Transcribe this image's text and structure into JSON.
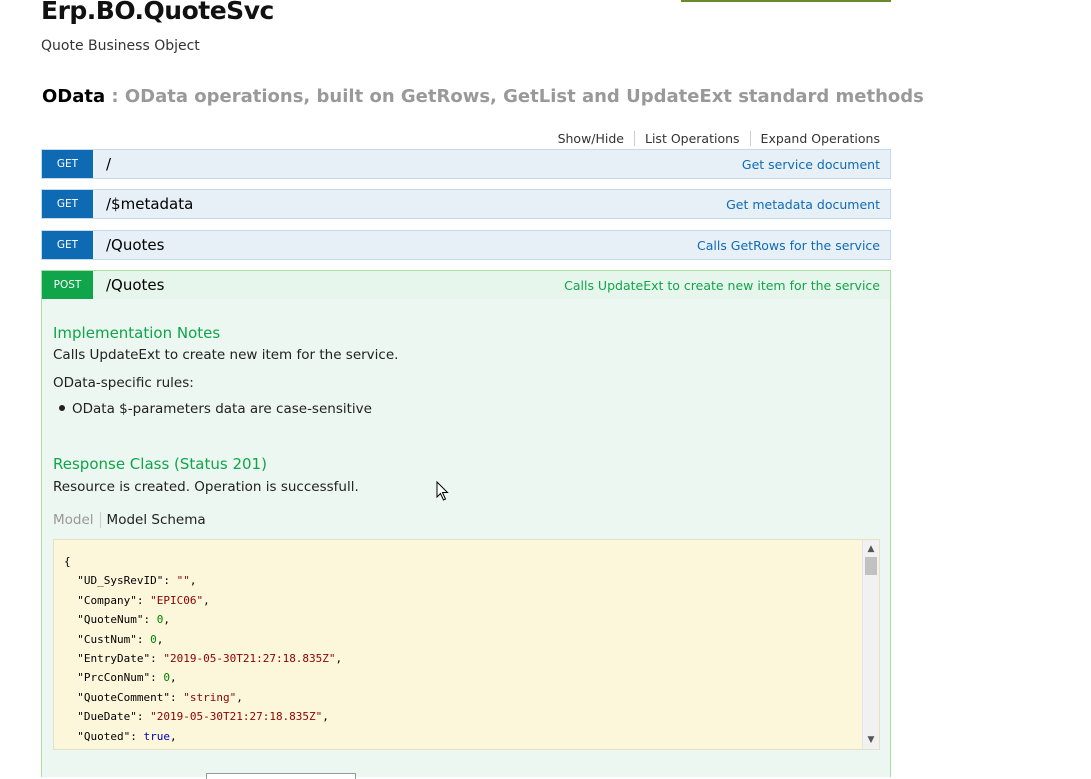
{
  "service": {
    "title": "Erp.BO.QuoteSvc",
    "subtitle": "Quote Business Object"
  },
  "section": {
    "name": "OData",
    "separator": " : ",
    "description": "OData operations, built on GetRows, GetList and UpdateExt standard methods"
  },
  "ops_links": [
    "Show/Hide",
    "List Operations",
    "Expand Operations"
  ],
  "operations": [
    {
      "method": "GET",
      "path": "/",
      "summary": "Get service document"
    },
    {
      "method": "GET",
      "path": "/$metadata",
      "summary": "Get metadata document"
    },
    {
      "method": "GET",
      "path": "/Quotes",
      "summary": "Calls GetRows for the service"
    },
    {
      "method": "POST",
      "path": "/Quotes",
      "summary": "Calls UpdateExt to create new item for the service"
    }
  ],
  "post_detail": {
    "impl_heading": "Implementation Notes",
    "impl_text": "Calls UpdateExt to create new item for the service.",
    "rules_heading": "OData-specific rules:",
    "rules": [
      "OData $-parameters data are case-sensitive"
    ],
    "response_heading": "Response Class (Status 201)",
    "response_text": "Resource is created. Operation is successfull.",
    "tabs": {
      "model": "Model",
      "schema": "Model Schema"
    },
    "schema_open": "{",
    "schema_fields": [
      {
        "key": "\"UD_SysRevID\"",
        "value": "\"\"",
        "kind": "s"
      },
      {
        "key": "\"Company\"",
        "value": "\"EPIC06\"",
        "kind": "s"
      },
      {
        "key": "\"QuoteNum\"",
        "value": "0",
        "kind": "n"
      },
      {
        "key": "\"CustNum\"",
        "value": "0",
        "kind": "n"
      },
      {
        "key": "\"EntryDate\"",
        "value": "\"2019-05-30T21:27:18.835Z\"",
        "kind": "s"
      },
      {
        "key": "\"PrcConNum\"",
        "value": "0",
        "kind": "n"
      },
      {
        "key": "\"QuoteComment\"",
        "value": "\"string\"",
        "kind": "s"
      },
      {
        "key": "\"DueDate\"",
        "value": "\"2019-05-30T21:27:18.835Z\"",
        "kind": "s"
      },
      {
        "key": "\"Quoted\"",
        "value": "true",
        "kind": "b"
      }
    ]
  },
  "colors": {
    "get_method": "#0f6ab4",
    "post_method": "#10a54a",
    "schema_bg": "#fcf6db"
  }
}
